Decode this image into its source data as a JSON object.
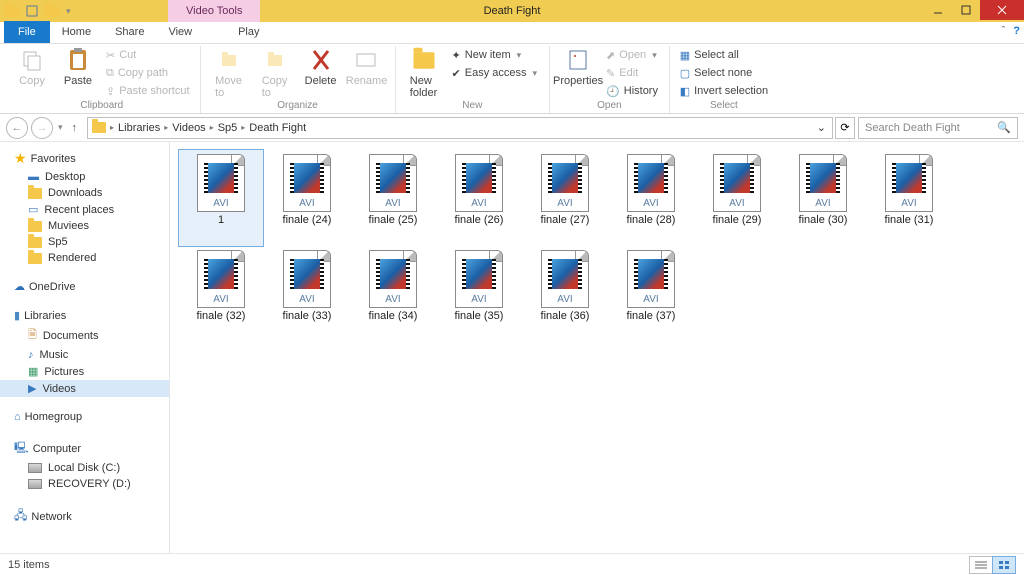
{
  "window": {
    "title": "Death Fight",
    "tool_tab": "Video Tools"
  },
  "tabs": {
    "file": "File",
    "home": "Home",
    "share": "Share",
    "view": "View",
    "play": "Play"
  },
  "ribbon": {
    "clipboard": {
      "copy": "Copy",
      "paste": "Paste",
      "cut": "Cut",
      "copy_path": "Copy path",
      "paste_shortcut": "Paste shortcut",
      "label": "Clipboard"
    },
    "organize": {
      "move": "Move\nto",
      "copy": "Copy\nto",
      "delete": "Delete",
      "rename": "Rename",
      "label": "Organize"
    },
    "new": {
      "folder": "New\nfolder",
      "new_item": "New item",
      "easy_access": "Easy access",
      "label": "New"
    },
    "open": {
      "properties": "Properties",
      "open": "Open",
      "edit": "Edit",
      "history": "History",
      "label": "Open"
    },
    "select": {
      "all": "Select all",
      "none": "Select none",
      "invert": "Invert selection",
      "label": "Select"
    }
  },
  "breadcrumb": [
    "Libraries",
    "Videos",
    "Sp5",
    "Death Fight"
  ],
  "search_placeholder": "Search Death Fight",
  "nav": {
    "favorites": {
      "label": "Favorites",
      "items": [
        "Desktop",
        "Downloads",
        "Recent places",
        "Muviees",
        "Sp5",
        "Rendered"
      ]
    },
    "onedrive": "OneDrive",
    "libraries": {
      "label": "Libraries",
      "items": [
        "Documents",
        "Music",
        "Pictures",
        "Videos"
      ],
      "selected": "Videos"
    },
    "homegroup": "Homegroup",
    "computer": {
      "label": "Computer",
      "items": [
        "Local Disk (C:)",
        "RECOVERY (D:)"
      ]
    },
    "network": "Network"
  },
  "avi_label": "AVI",
  "files": [
    {
      "name": "1",
      "selected": true
    },
    {
      "name": "finale (24)"
    },
    {
      "name": "finale (25)"
    },
    {
      "name": "finale (26)"
    },
    {
      "name": "finale (27)"
    },
    {
      "name": "finale (28)"
    },
    {
      "name": "finale (29)"
    },
    {
      "name": "finale (30)"
    },
    {
      "name": "finale (31)"
    },
    {
      "name": "finale (32)"
    },
    {
      "name": "finale (33)"
    },
    {
      "name": "finale (34)"
    },
    {
      "name": "finale (35)"
    },
    {
      "name": "finale (36)"
    },
    {
      "name": "finale (37)"
    }
  ],
  "status": "15 items"
}
